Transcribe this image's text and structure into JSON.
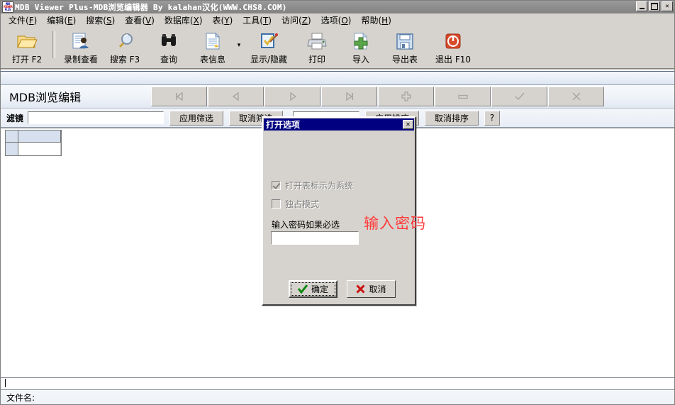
{
  "window": {
    "title": "MDB Viewer Plus-MDB浏览编辑器 By kalahan汉化(WWW.CHS8.COM)",
    "icon_line1": "MDB",
    "icon_line2": "VIEWER",
    "icon_line3": "PLUS",
    "minimize_label": "_",
    "maximize_label": "□",
    "close_label": "✕"
  },
  "menu": {
    "items": [
      {
        "label": "文件",
        "accel": "F"
      },
      {
        "label": "编辑",
        "accel": "E"
      },
      {
        "label": "搜索",
        "accel": "S"
      },
      {
        "label": "查看",
        "accel": "V"
      },
      {
        "label": "数据库",
        "accel": "X"
      },
      {
        "label": "表",
        "accel": "Y"
      },
      {
        "label": "工具",
        "accel": "T"
      },
      {
        "label": "访问",
        "accel": "Z"
      },
      {
        "label": "选项",
        "accel": "O"
      },
      {
        "label": "帮助",
        "accel": "H"
      }
    ]
  },
  "toolbar": {
    "items": [
      {
        "label": "打开 F2",
        "icon": "open-folder-icon"
      },
      {
        "label": "录制查看",
        "icon": "record-view-icon"
      },
      {
        "label": "搜索 F3",
        "icon": "magnifier-icon"
      },
      {
        "label": "查询",
        "icon": "binoculars-icon"
      },
      {
        "label": "表信息",
        "icon": "table-info-icon"
      },
      {
        "label": "显示/隐藏",
        "icon": "show-hide-icon"
      },
      {
        "label": "打印",
        "icon": "printer-icon"
      },
      {
        "label": "导入",
        "icon": "import-icon"
      },
      {
        "label": "导出表",
        "icon": "export-floppy-icon"
      },
      {
        "label": "退出 F10",
        "icon": "exit-power-icon"
      }
    ],
    "dropdown_arrow": "▾"
  },
  "browse": {
    "title": "MDB浏览编辑",
    "nav_buttons": [
      {
        "name": "first-record-button",
        "icon": "first-record-icon"
      },
      {
        "name": "prev-record-button",
        "icon": "prev-record-icon"
      },
      {
        "name": "next-record-button",
        "icon": "next-record-icon"
      },
      {
        "name": "last-record-button",
        "icon": "last-record-icon"
      },
      {
        "name": "add-record-button",
        "icon": "plus-icon"
      },
      {
        "name": "delete-record-button",
        "icon": "minus-icon"
      },
      {
        "name": "confirm-edit-button",
        "icon": "check-icon"
      },
      {
        "name": "cancel-edit-button",
        "icon": "cross-icon"
      }
    ]
  },
  "filterbar": {
    "filter_label": "滤镜",
    "filter_value": "",
    "apply_filter_label": "应用筛选",
    "cancel_filter_label": "取消筛选",
    "sort_value": "",
    "apply_sort_label": "应用排序",
    "cancel_sort_label": "取消排序",
    "help_label": "?"
  },
  "status": {
    "filename_label": "文件名:",
    "bottom_field_value": ""
  },
  "dialog": {
    "title": "打开选项",
    "close_label": "✕",
    "checkbox_system": {
      "label": "打开表标示为系统",
      "checked": true,
      "disabled": true
    },
    "checkbox_exclusive": {
      "label": "独占模式",
      "checked": false,
      "disabled": true
    },
    "password_label": "输入密码如果必选",
    "password_value": "",
    "ok_label": "确定",
    "cancel_label": "取消"
  },
  "annotation": {
    "text": "输入密码",
    "color": "#ff3b3b"
  }
}
